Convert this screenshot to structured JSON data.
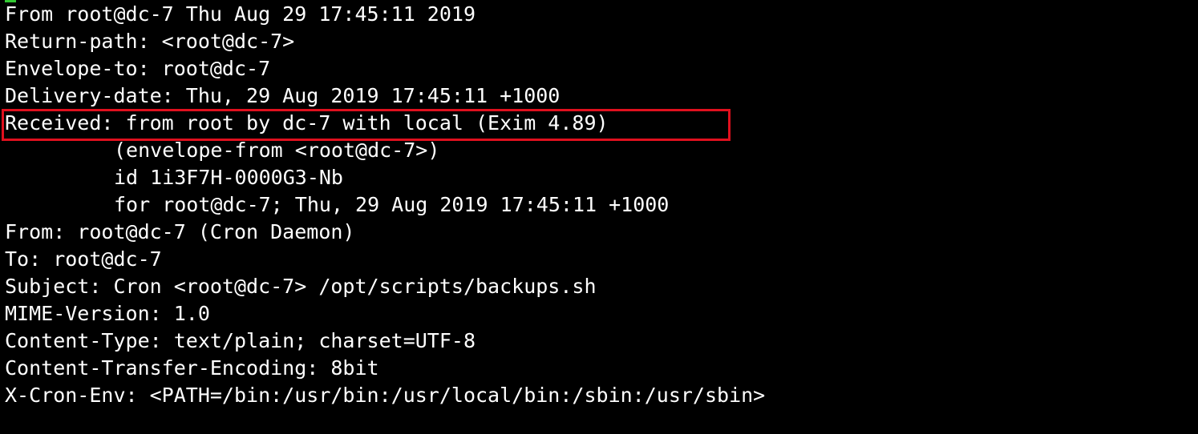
{
  "colors": {
    "background": "#000000",
    "text": "#ffffff",
    "highlight_border": "#e0101e",
    "cursor": "#32c832"
  },
  "terminal": {
    "lines": [
      "From root@dc-7 Thu Aug 29 17:45:11 2019",
      "Return-path: <root@dc-7>",
      "Envelope-to: root@dc-7",
      "Delivery-date: Thu, 29 Aug 2019 17:45:11 +1000",
      "Received: from root by dc-7 with local (Exim 4.89)",
      "(envelope-from <root@dc-7>)",
      "id 1i3F7H-0000G3-Nb",
      "for root@dc-7; Thu, 29 Aug 2019 17:45:11 +1000",
      "From: root@dc-7 (Cron Daemon)",
      "To: root@dc-7",
      "Subject: Cron <root@dc-7> /opt/scripts/backups.sh",
      "MIME-Version: 1.0",
      "Content-Type: text/plain; charset=UTF-8",
      "Content-Transfer-Encoding: 8bit",
      "X-Cron-Env: <PATH=/bin:/usr/bin:/usr/local/bin:/sbin:/usr/sbin>"
    ]
  }
}
